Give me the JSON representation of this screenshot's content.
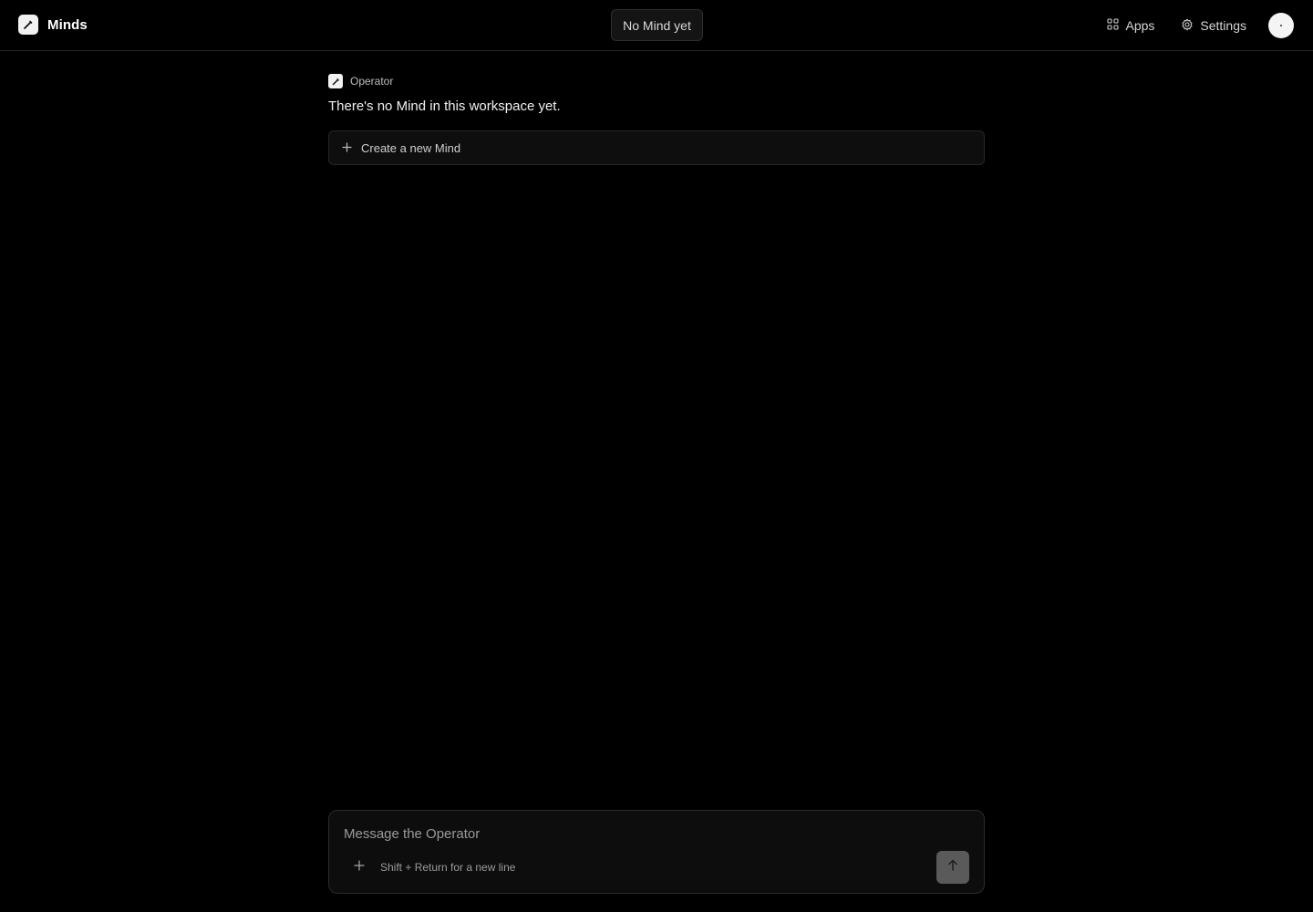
{
  "header": {
    "brand_name": "Minds",
    "brand_icon": "pen-nib-icon",
    "mind_selector_label": "No Mind yet",
    "apps_label": "Apps",
    "apps_icon": "apps-grid-icon",
    "settings_label": "Settings",
    "settings_icon": "gear-icon",
    "avatar_icon": "user-avatar"
  },
  "thread": {
    "sender": "Operator",
    "message": "There's no Mind in this workspace yet.",
    "create_label": "Create a new Mind"
  },
  "composer": {
    "placeholder": "Message the Operator",
    "hint": "Shift + Return for a new line",
    "send_icon": "arrow-up-icon"
  },
  "colors": {
    "background": "#000000",
    "surface": "#0d0d0d",
    "border": "#262626",
    "send_button": "#5a5a5a"
  }
}
